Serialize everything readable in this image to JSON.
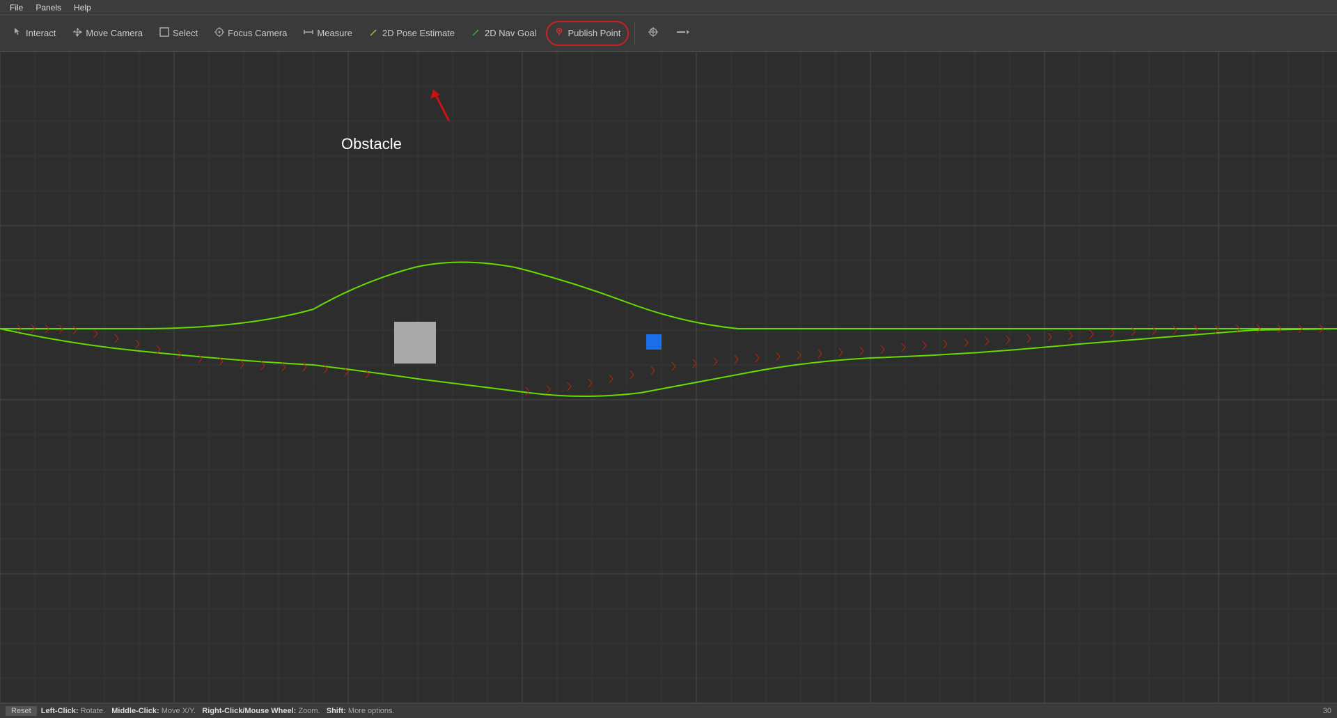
{
  "menu": {
    "items": [
      "File",
      "Panels",
      "Help"
    ]
  },
  "toolbar": {
    "tools": [
      {
        "id": "interact",
        "label": "Interact",
        "icon": "⬛",
        "active": false
      },
      {
        "id": "move-camera",
        "label": "Move Camera",
        "icon": "✥",
        "active": false
      },
      {
        "id": "select",
        "label": "Select",
        "icon": "▱",
        "active": false
      },
      {
        "id": "focus-camera",
        "label": "Focus Camera",
        "icon": "⊕",
        "active": false
      },
      {
        "id": "measure",
        "label": "Measure",
        "icon": "⟺",
        "active": false
      },
      {
        "id": "2d-pose-estimate",
        "label": "2D Pose Estimate",
        "icon": "↗",
        "active": false
      },
      {
        "id": "2d-nav-goal",
        "label": "2D Nav Goal",
        "icon": "↗",
        "active": false
      },
      {
        "id": "publish-point",
        "label": "Publish Point",
        "icon": "📍",
        "active": true
      }
    ],
    "extra_icon_1": "⊕",
    "extra_icon_2": "—"
  },
  "viewport": {
    "obstacle_label": "Obstacle",
    "grid_color": "#3a3a3a",
    "background_color": "#2d2d2d"
  },
  "status_bar": {
    "reset_label": "Reset",
    "hint_left": "Left-Click:",
    "hint_left_val": "Rotate.",
    "hint_middle": "Middle-Click:",
    "hint_middle_val": "Move X/Y.",
    "hint_right": "Right-Click/Mouse Wheel:",
    "hint_right_val": "Zoom.",
    "hint_shift": "Shift:",
    "hint_shift_val": "More options.",
    "number": "30"
  },
  "annotation": {
    "arrow_color": "#cc1111"
  }
}
